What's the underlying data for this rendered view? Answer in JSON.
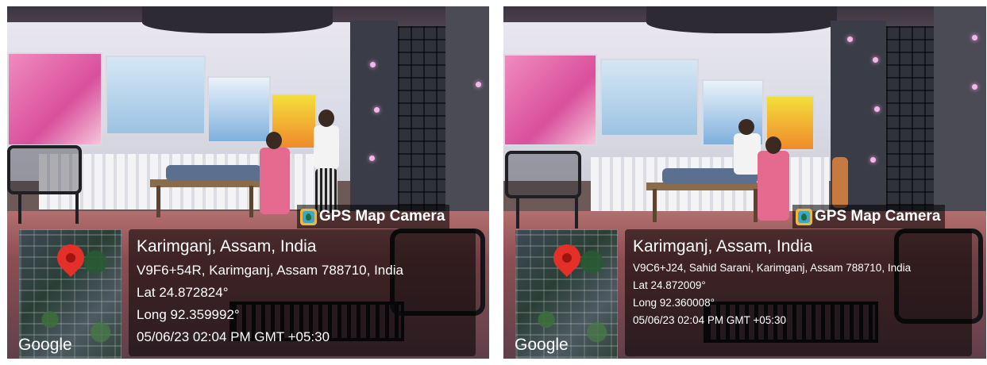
{
  "panels": [
    {
      "badge": "GPS Map Camera",
      "map_brand": "Google",
      "map_icon": "location-pin-icon",
      "location_title": "Karimganj, Assam, India",
      "address": "V9F6+54R, Karimganj, Assam 788710, India",
      "latitude": "Lat 24.872824°",
      "longitude": "Long 92.359992°",
      "datetime": "05/06/23 02:04 PM GMT +05:30"
    },
    {
      "badge": "GPS Map Camera",
      "map_brand": "Google",
      "map_icon": "location-pin-icon",
      "location_title": "Karimganj, Assam, India",
      "address": "V9C6+J24, Sahid Sarani, Karimganj, Assam 788710, India",
      "latitude": "Lat 24.872009°",
      "longitude": "Long 92.360008°",
      "datetime": "05/06/23 02:04 PM GMT +05:30"
    }
  ]
}
